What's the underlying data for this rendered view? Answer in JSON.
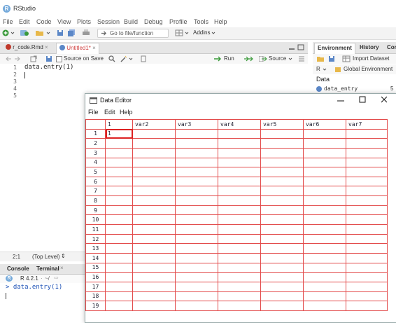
{
  "app": {
    "title": "RStudio"
  },
  "menubar": [
    "File",
    "Edit",
    "Code",
    "View",
    "Plots",
    "Session",
    "Build",
    "Debug",
    "Profile",
    "Tools",
    "Help"
  ],
  "toolbar": {
    "goto_placeholder": "Go to file/function",
    "addins": "Addins"
  },
  "source": {
    "tabs": [
      {
        "label": "r_code.Rmd"
      },
      {
        "label": "Untitled1*"
      }
    ],
    "source_on_save": "Source on Save",
    "run": "Run",
    "source_btn": "Source",
    "lines": [
      "1",
      "2",
      "3",
      "4",
      "5"
    ],
    "code": [
      "data.entry(1)"
    ],
    "cursor_pos": "2:1",
    "scope": "(Top Level)"
  },
  "console": {
    "tabs": [
      "Console",
      "Terminal"
    ],
    "version": "R 4.2.1",
    "path": "~/",
    "history_line": "> data.entry(1)"
  },
  "environment": {
    "tabs": [
      "Environment",
      "History",
      "Cor"
    ],
    "import_dataset": "Import Dataset",
    "lang": "R",
    "scope": "Global Environment",
    "section": "Data",
    "rows": [
      {
        "name": "data_entry",
        "value": "5"
      }
    ]
  },
  "data_editor": {
    "title": "Data Editor",
    "menu": [
      "File",
      "Edit",
      "Help"
    ],
    "columns": [
      "1",
      "var2",
      "var3",
      "var4",
      "var5",
      "var6",
      "var7"
    ],
    "rows": [
      "1",
      "2",
      "3",
      "4",
      "5",
      "6",
      "7",
      "8",
      "9",
      "10",
      "11",
      "12",
      "13",
      "14",
      "15",
      "16",
      "17",
      "18",
      "19"
    ],
    "cells": {
      "0": [
        "1"
      ]
    },
    "grid_color": "#e34b4b"
  }
}
